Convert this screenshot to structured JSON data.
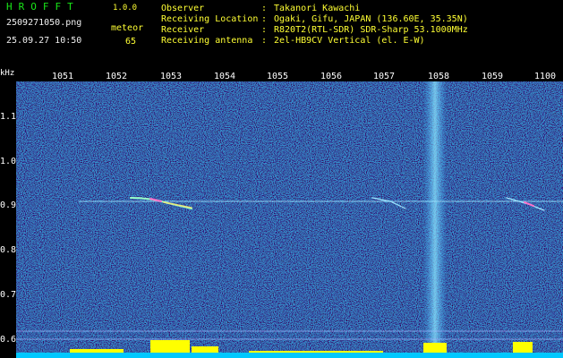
{
  "header": {
    "app_title": "HROFFT",
    "app_version": "1.0.0",
    "file_name": "2509271050.png",
    "timestamp": "25.09.27 10:50",
    "count_label": "meteor",
    "count_value": "65",
    "info_rows": [
      {
        "label": "Observer",
        "colon": ":",
        "value": "Takanori Kawachi"
      },
      {
        "label": "Receiving Location",
        "colon": ":",
        "value": "Ogaki, Gifu, JAPAN (136.60E, 35.35N)"
      },
      {
        "label": "Receiver",
        "colon": ":",
        "value": "R820T2(RTL-SDR) SDR-Sharp 53.1000MHz"
      },
      {
        "label": "Receiving antenna",
        "colon": ":",
        "value": "2el-HB9CV Vertical (el. E-W)"
      }
    ]
  },
  "axes": {
    "y_unit": "kHz",
    "y_ticks": [
      "1.1",
      "1.0",
      "0.9",
      "0.8",
      "0.7",
      "0.6"
    ],
    "x_ticks": [
      "1051",
      "1052",
      "1053",
      "1054",
      "1055",
      "1056",
      "1057",
      "1058",
      "1059",
      "1100"
    ]
  },
  "colors": {
    "background": "#00008c",
    "trace": "#a0e6ff",
    "histogram": "#ffff00",
    "baseline": "#00c8ff"
  }
}
